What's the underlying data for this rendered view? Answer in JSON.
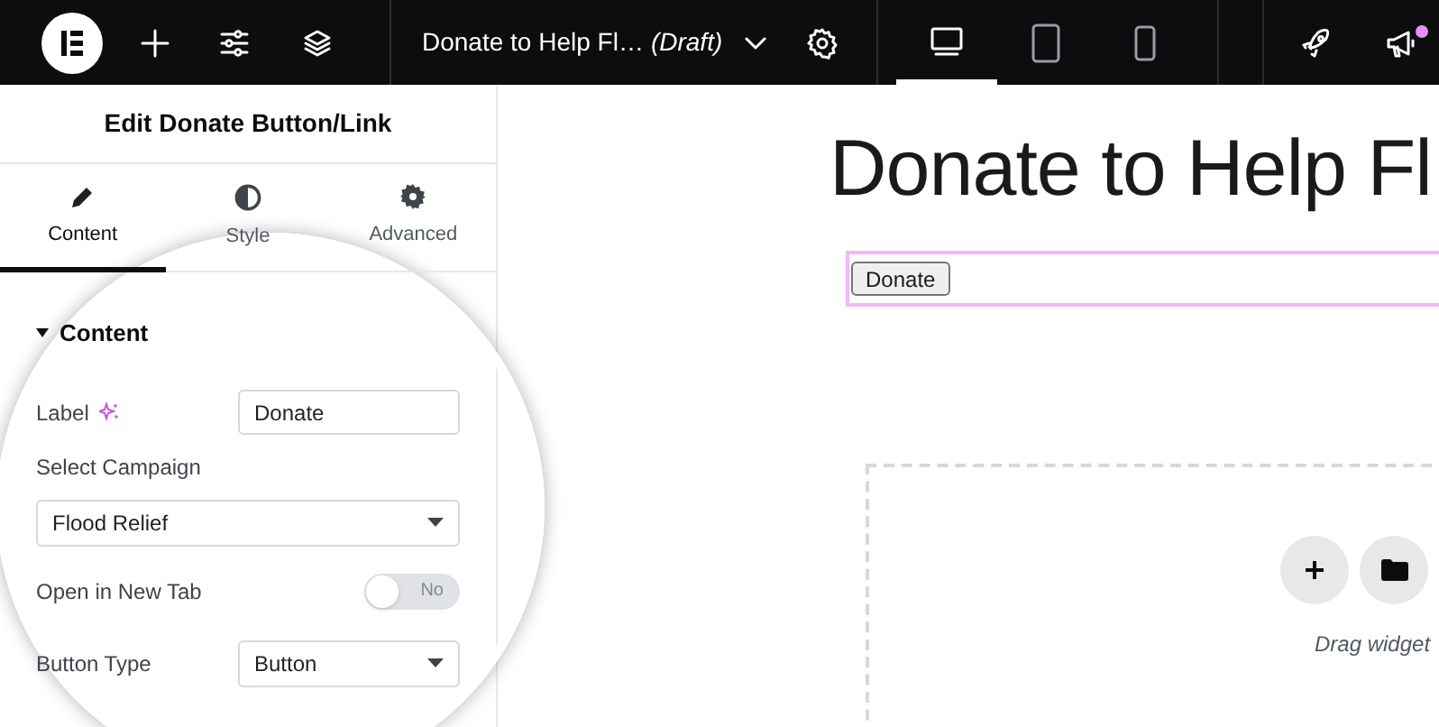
{
  "topbar": {
    "title": "Donate to Help Fl…",
    "status": "(Draft)",
    "devices": [
      {
        "kind": "desktop",
        "selected": true
      },
      {
        "kind": "tablet",
        "selected": false
      },
      {
        "kind": "mobile",
        "selected": false
      }
    ],
    "has_notification": true
  },
  "panel": {
    "title": "Edit Donate Button/Link",
    "tabs": [
      {
        "kind": "content",
        "label": "Content",
        "selected": true
      },
      {
        "kind": "style",
        "label": "Style",
        "selected": false
      },
      {
        "kind": "advanced",
        "label": "Advanced",
        "selected": false
      }
    ],
    "section": {
      "title": "Content",
      "expanded": true
    },
    "controls": [
      {
        "kind": "text",
        "label": "Label",
        "value": "Donate"
      },
      {
        "kind": "select_block",
        "label": "Select Campaign",
        "value": "Flood Relief"
      },
      {
        "kind": "toggle",
        "label": "Open in New Tab",
        "on": false,
        "off_label": "No"
      },
      {
        "kind": "select",
        "label": "Button Type",
        "value": "Button"
      }
    ]
  },
  "canvas": {
    "heading": "Donate to Help Fl",
    "button": "Donate",
    "drop_hint": "Drag widget"
  }
}
